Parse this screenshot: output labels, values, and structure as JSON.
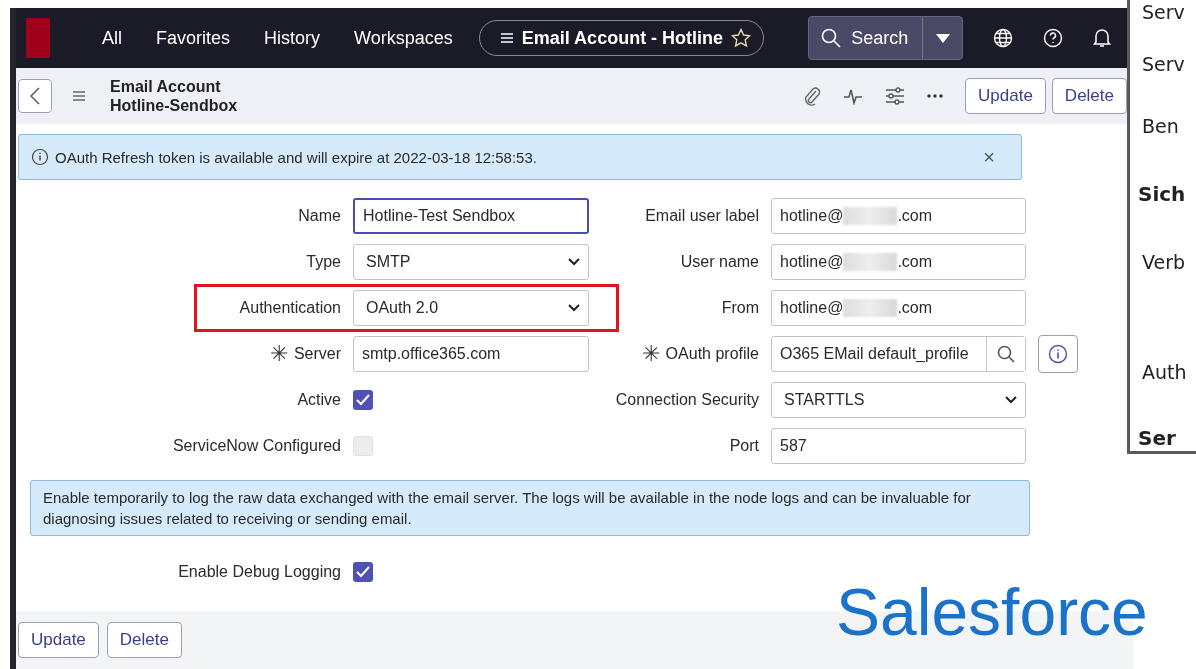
{
  "nav": {
    "items": [
      "All",
      "Favorites",
      "History",
      "Workspaces"
    ],
    "title_pill": "Email Account - Hotline",
    "search": "Search"
  },
  "header": {
    "title": "Email Account",
    "subtitle": "Hotline-Sendbox",
    "buttons": [
      "Update",
      "Delete"
    ]
  },
  "banner": {
    "text": "OAuth Refresh token is available and will expire at 2022-03-18 12:58:53.",
    "close": "×"
  },
  "form": {
    "left": [
      {
        "label": "Name",
        "kind": "text",
        "value": "Hotline-Test Sendbox",
        "focused": true
      },
      {
        "label": "Type",
        "kind": "select",
        "value": "SMTP"
      },
      {
        "label": "Authentication",
        "kind": "select",
        "value": "OAuth 2.0",
        "highlighted": true
      },
      {
        "label": "Server",
        "kind": "text",
        "value": "smtp.office365.com",
        "required_mark": "✳"
      },
      {
        "label": "Active",
        "kind": "checkbox",
        "checked": true
      },
      {
        "label": "ServiceNow Configured",
        "kind": "checkbox",
        "checked": false,
        "disabled": true
      }
    ],
    "right": [
      {
        "label": "Email user label",
        "kind": "email",
        "value": "hotline@",
        "suffix": ".com"
      },
      {
        "label": "User name",
        "kind": "email",
        "value": "hotline@",
        "suffix": ".com"
      },
      {
        "label": "From",
        "kind": "email",
        "value": "hotline@",
        "suffix": ".com"
      },
      {
        "label": "OAuth profile",
        "kind": "reference",
        "value": "O365 EMail default_profile",
        "required_mark": "✳"
      },
      {
        "label": "Connection Security",
        "kind": "select",
        "value": "STARTTLS"
      },
      {
        "label": "Port",
        "kind": "text",
        "value": "587"
      }
    ]
  },
  "note": "Enable temporarily to log the raw data exchanged with the email server. The logs will be available in the node logs and can be invaluable for diagnosing issues related to receiving or sending email.",
  "debug": {
    "label": "Enable Debug Logging",
    "checked": true
  },
  "footer_buttons": [
    "Update",
    "Delete"
  ],
  "caption": "Salesforce",
  "side_dialog": {
    "items": [
      {
        "text": "Serv",
        "kind": "label"
      },
      {
        "text": "Serv",
        "kind": "label"
      },
      {
        "text": "Ben",
        "kind": "label"
      },
      {
        "text": "Sich",
        "kind": "heading"
      },
      {
        "text": "Verb",
        "kind": "label"
      },
      {
        "text": "Auth",
        "kind": "label"
      },
      {
        "text": "Ser",
        "kind": "heading"
      }
    ]
  }
}
